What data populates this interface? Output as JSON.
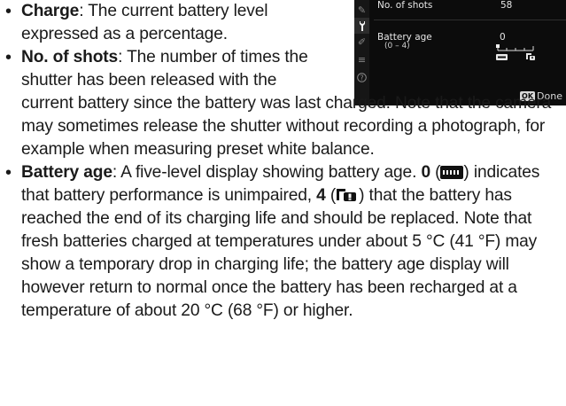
{
  "camera_menu": {
    "shots_label": "No. of shots",
    "shots_value": "58",
    "age_label": "Battery age",
    "age_range": "(0 – 4)",
    "age_value": "0",
    "age_level": 0,
    "ok_badge": "OK",
    "done_label": "Done",
    "sidebar_icons": [
      "pencil-icon",
      "wrench-icon",
      "retouch-icon",
      "mymenu-icon",
      "help-icon"
    ],
    "active_sidebar_index": 1
  },
  "items": {
    "charge": {
      "term": "Charge",
      "text_1": ": The current battery level",
      "text_2": "expressed as a percentage."
    },
    "shots": {
      "term": "No. of shots",
      "text_1": ": The number of times the",
      "text_2": "shutter has been released with the",
      "text_3": "current battery since the battery was last charged. Note that the camera may sometimes release the shutter without recording a photograph, for example when measuring preset white balance."
    },
    "age": {
      "term": "Battery age",
      "text_1": ": A five-level display showing battery age. ",
      "level_0": "0",
      "text_2": " indicates that battery performance is unimpaired, ",
      "level_4": "4",
      "text_3": " that the battery has reached the end of its charging life and should be replaced. Note that fresh batteries charged at temperatures under about 5 °C (41 °F) may show a temporary drop in charging life; the battery age display will however return to normal once the battery has been recharged at a temperature of about 20 °C (68 °F) or higher."
    }
  }
}
